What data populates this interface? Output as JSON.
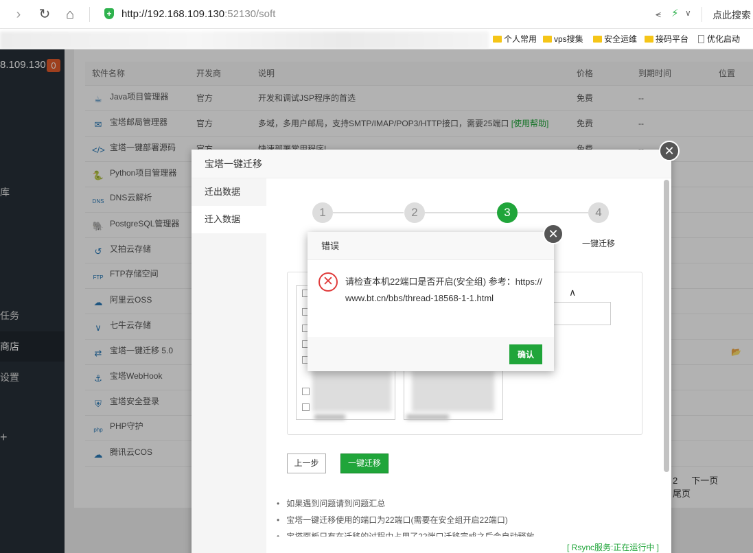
{
  "browser": {
    "url_host": "http://192.168.109.130",
    "url_port_path": ":52130/soft",
    "search_hint": "点此搜索",
    "bookmarks": [
      "个人常用",
      "vps搜集",
      "安全运维",
      "接码平台",
      "优化启动"
    ]
  },
  "sidebar": {
    "ip": "8.109.130",
    "badge": "0",
    "items": [
      "库",
      "任务",
      "商店",
      "设置",
      "+"
    ]
  },
  "table": {
    "headers": [
      "软件名称",
      "开发商",
      "说明",
      "价格",
      "到期时间",
      "位置"
    ],
    "rows": [
      {
        "name": "Java项目管理器",
        "dev": "官方",
        "desc": "开发和调试JSP程序的首选",
        "help": "",
        "price": "免费",
        "expire": "--",
        "icon": "java-icon"
      },
      {
        "name": "宝塔邮局管理器",
        "dev": "官方",
        "desc": "多域，多用户邮局，支持SMTP/IMAP/POP3/HTTP接口，需要25端口",
        "help": "[使用帮助]",
        "price": "免费",
        "expire": "--",
        "icon": "mail-icon"
      },
      {
        "name": "宝塔一键部署源码",
        "dev": "官方",
        "desc": "快速部署常用程序!",
        "help": "",
        "price": "免费",
        "expire": "--",
        "icon": "code-icon"
      },
      {
        "name": "Python项目管理器",
        "dev": "",
        "desc": "",
        "help": "",
        "price": "",
        "expire": "",
        "icon": "python-icon"
      },
      {
        "name": "DNS云解析",
        "dev": "",
        "desc": "",
        "help": "",
        "price": "",
        "expire": "",
        "icon": "dns-icon"
      },
      {
        "name": "PostgreSQL管理器",
        "dev": "",
        "desc": "",
        "help": "",
        "price": "",
        "expire": "",
        "icon": "postgresql-icon"
      },
      {
        "name": "又拍云存储",
        "dev": "",
        "desc": "",
        "help": "",
        "price": "",
        "expire": "",
        "icon": "upyun-icon"
      },
      {
        "name": "FTP存储空间",
        "dev": "",
        "desc": "",
        "help": "",
        "price": "",
        "expire": "",
        "icon": "ftp-icon"
      },
      {
        "name": "阿里云OSS",
        "dev": "",
        "desc": "",
        "help": "",
        "price": "",
        "expire": "",
        "icon": "aliyun-icon"
      },
      {
        "name": "七牛云存储",
        "dev": "",
        "desc": "",
        "help": "",
        "price": "",
        "expire": "",
        "icon": "qiniu-icon"
      },
      {
        "name": "宝塔一键迁移 5.0",
        "dev": "",
        "desc": "",
        "help": "",
        "price": "",
        "expire": "",
        "icon": "migrate-icon"
      },
      {
        "name": "宝塔WebHook",
        "dev": "",
        "desc": "",
        "help": "",
        "price": "",
        "expire": "",
        "icon": "webhook-icon"
      },
      {
        "name": "宝塔安全登录",
        "dev": "",
        "desc": "",
        "help": "",
        "price": "",
        "expire": "",
        "icon": "shield-icon"
      },
      {
        "name": "PHP守护",
        "dev": "",
        "desc": "",
        "help": "",
        "price": "",
        "expire": "",
        "icon": "php-icon"
      },
      {
        "name": "腾讯云COS",
        "dev": "",
        "desc": "",
        "help": "",
        "price": "",
        "expire": "",
        "icon": "tencent-cloud-icon"
      }
    ]
  },
  "pager": {
    "page": "2",
    "next": "下一页",
    "last": "尾页"
  },
  "migration": {
    "title": "宝塔一键迁移",
    "tabs": [
      "迁出数据",
      "迁入数据"
    ],
    "steps": [
      "1",
      "2",
      "3",
      "4"
    ],
    "step4_label": "一键迁移",
    "prev_label": "上一步",
    "go_label": "一键迁移",
    "notes": [
      "如果遇到问题请到问题汇总",
      "宝塔一键迁移使用的端口为22端口(需要在安全组开启22端口)",
      "宝塔面板只有在迁移的过程中占用了22端口迁移完成之后会自动释放"
    ],
    "rsync_status": "[ Rsync服务:正在运行中 ]"
  },
  "error_dialog": {
    "title": "错误",
    "message": "请检查本机22端口是否开启(安全组) 参考：https://www.bt.cn/bbs/thread-18568-1-1.html",
    "ok_label": "确认"
  },
  "colors": {
    "accent": "#20a53a",
    "error": "#e03c3c",
    "sidebar": "#283038"
  }
}
